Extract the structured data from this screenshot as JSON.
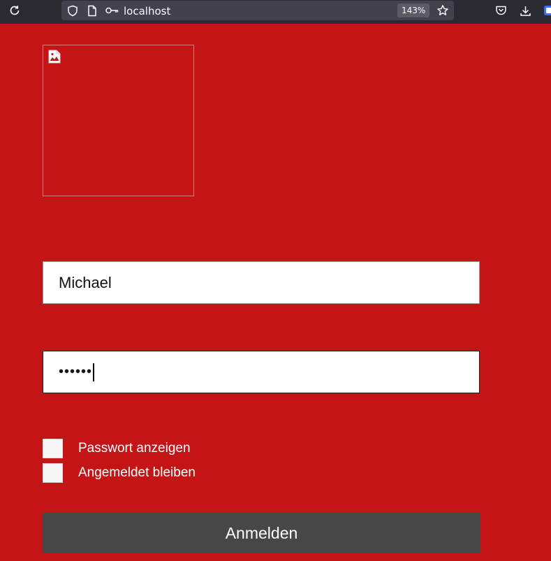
{
  "browser": {
    "url": "localhost",
    "zoom": "143%",
    "icons": [
      "reload-icon",
      "shield-icon",
      "page-icon",
      "key-icon",
      "star-icon",
      "pocket-icon",
      "download-icon",
      "extension-icon"
    ]
  },
  "login": {
    "logo_alt": "",
    "username_value": "Michael",
    "password_masked": "••••••",
    "show_password_label": "Passwort anzeigen",
    "remember_me_label": "Angemeldet bleiben",
    "submit_label": "Anmelden"
  },
  "colors": {
    "background": "#c41415",
    "button": "#474747",
    "browser_chrome": "#2b2a33"
  }
}
